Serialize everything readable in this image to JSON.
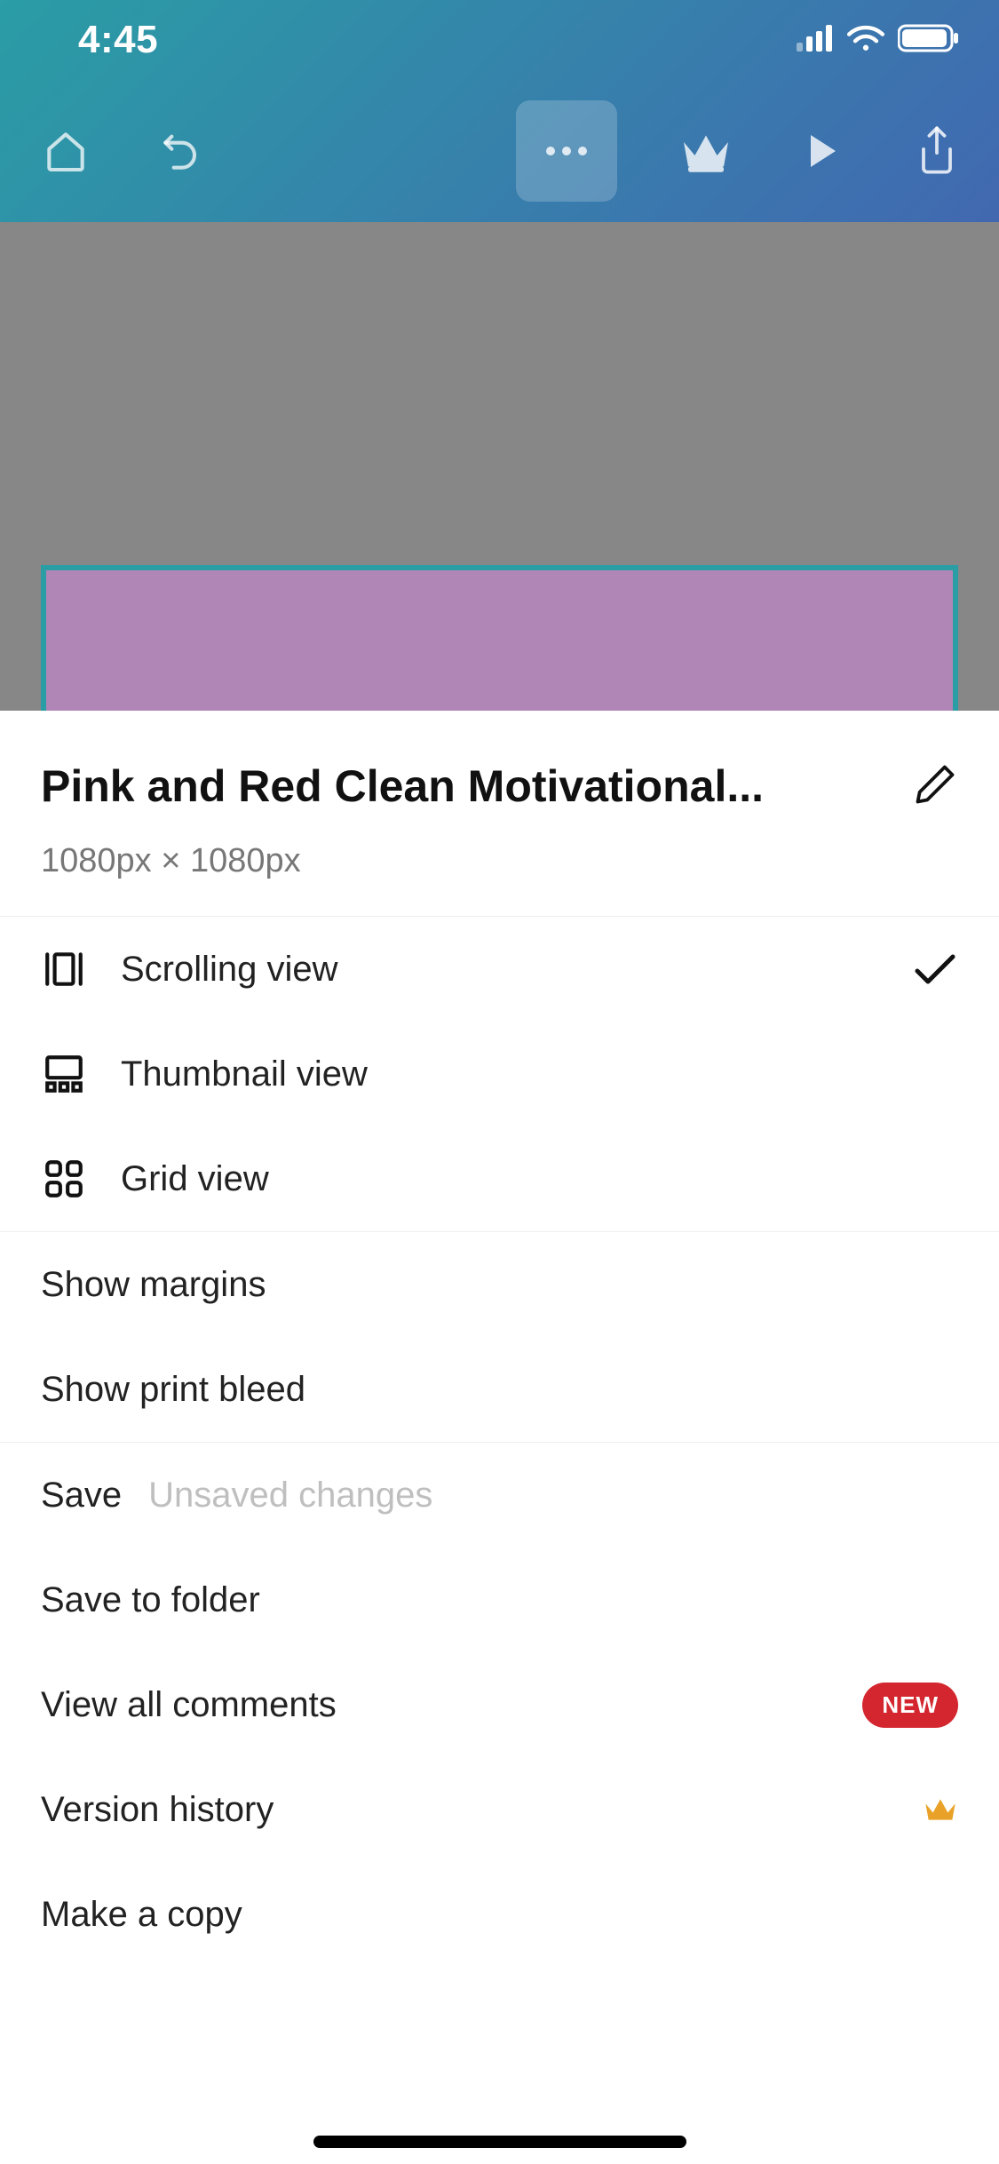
{
  "statusbar": {
    "time": "4:45"
  },
  "sheet": {
    "title": "Pink and Red Clean Motivational...",
    "dimensions": "1080px × 1080px"
  },
  "views": {
    "scrolling": {
      "label": "Scrolling view",
      "selected": true
    },
    "thumbnail": {
      "label": "Thumbnail view",
      "selected": false
    },
    "grid": {
      "label": "Grid view",
      "selected": false
    }
  },
  "display_options": {
    "margins": "Show margins",
    "print_bleed": "Show print bleed"
  },
  "actions": {
    "save": {
      "label": "Save",
      "status": "Unsaved changes"
    },
    "save_to_folder": "Save to folder",
    "view_comments": {
      "label": "View all comments",
      "badge": "NEW"
    },
    "version_history": "Version history",
    "make_copy": "Make a copy"
  }
}
